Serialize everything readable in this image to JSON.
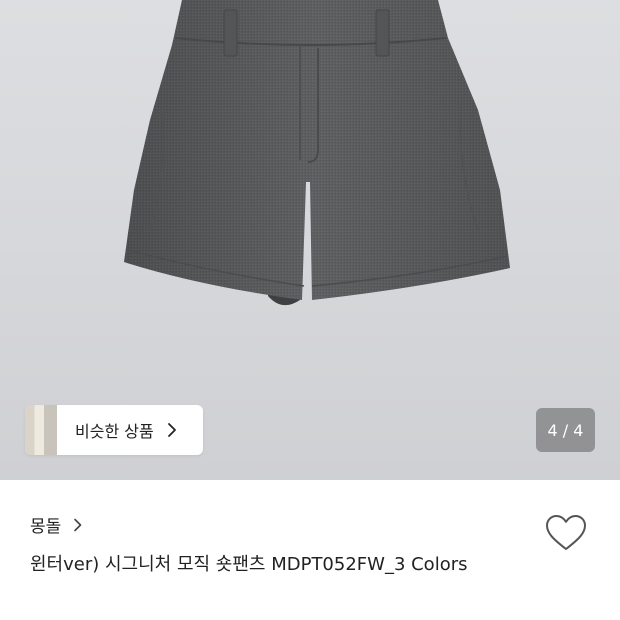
{
  "similar_products": {
    "label": "비슷한 상품"
  },
  "gallery": {
    "counter": "4 / 4"
  },
  "product": {
    "brand": "몽돌",
    "title": "윈터ver) 시그니처 모직 숏팬츠 MDPT052FW_3 Colors"
  },
  "icons": {
    "similar_chevron": "chevron-right-icon",
    "brand_chevron": "chevron-right-icon",
    "wishlist": "heart-outline-icon"
  },
  "colors": {
    "background": "#ffffff",
    "photo_background": "#d6d7da",
    "shorts": "#5d5e60",
    "counter_badge": "#5f5f5f",
    "text": "#222222"
  }
}
